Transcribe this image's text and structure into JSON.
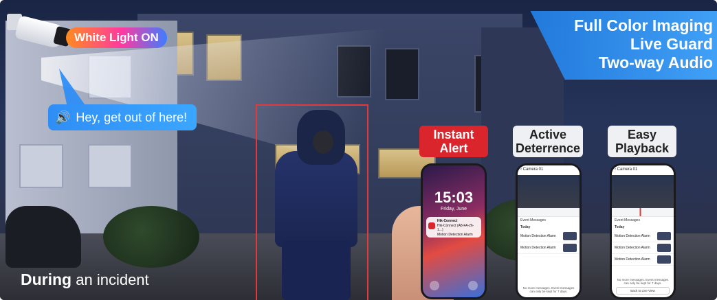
{
  "camera_tag": "White Light ON",
  "speaker_message": "Hey, get out of here!",
  "features": [
    "Full Color Imaging",
    "Live Guard",
    "Two-way Audio"
  ],
  "caption": {
    "bold": "During",
    "rest": "an incident"
  },
  "phones": [
    {
      "tag_line1": "Instant",
      "tag_line2": "Alert",
      "tag_style": "red",
      "time": "15:03",
      "date": "Friday, June",
      "notif_app": "Hik-Connect",
      "notif_line": "Hik-Connect (A8-FA-26-1...)",
      "notif_type": "Motion Detection Alarm"
    },
    {
      "tag_line1": "Active",
      "tag_line2": "Deterrence",
      "tag_style": "light",
      "header": "Camera 01",
      "section": "Event Messages",
      "today": "Today",
      "events": [
        "Motion Detection Alarm",
        "Motion Detection Alarm"
      ],
      "footer": "No more messages. Event messages can only be kept for 7 days."
    },
    {
      "tag_line1": "Easy",
      "tag_line2": "Playback",
      "tag_style": "light",
      "header": "Camera 01",
      "section": "Event Messages",
      "today": "Today",
      "events": [
        "Motion Detection Alarm",
        "Motion Detection Alarm",
        "Motion Detection Alarm"
      ],
      "footer": "No more messages. Event messages can only be kept for 7 days.",
      "button": "Back to Live View"
    }
  ],
  "colors": {
    "alert_red": "#d9252b",
    "accent_blue": "#2f8ef5",
    "detect_box": "#e23a3a"
  }
}
